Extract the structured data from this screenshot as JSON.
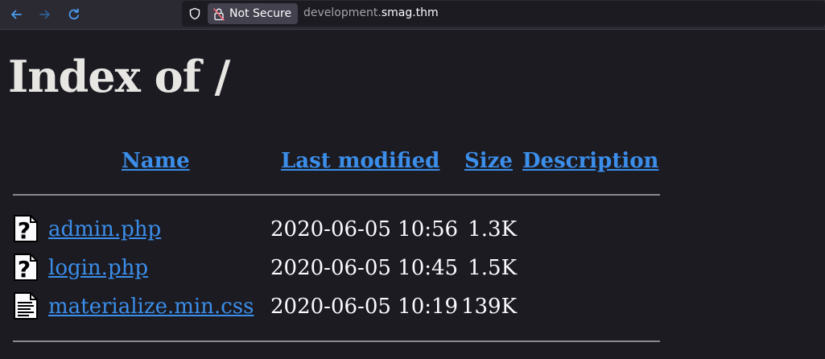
{
  "browser": {
    "security_label": "Not Secure",
    "url_subdomain": "development.",
    "url_domain": "smag.thm"
  },
  "page": {
    "title": "Index of /",
    "columns": {
      "name": "Name",
      "last_modified": "Last modified",
      "size": "Size",
      "description": "Description"
    },
    "files": [
      {
        "name": "admin.php",
        "modified": "2020-06-05 10:56",
        "size": "1.3K",
        "icon": "unknown-file-icon"
      },
      {
        "name": "login.php",
        "modified": "2020-06-05 10:45",
        "size": "1.5K",
        "icon": "unknown-file-icon"
      },
      {
        "name": "materialize.min.css",
        "modified": "2020-06-05 10:19",
        "size": "139K",
        "icon": "text-file-icon"
      }
    ]
  },
  "colors": {
    "link": "#3b8eea",
    "background": "#1c1b22",
    "toolbar": "#2b2a33"
  }
}
